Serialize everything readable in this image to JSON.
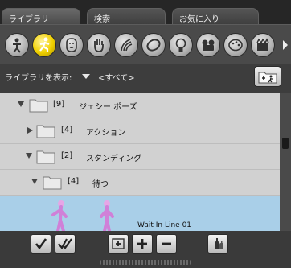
{
  "tabs": [
    {
      "label": "ライブラリ",
      "active": true
    },
    {
      "label": "検索",
      "active": false
    },
    {
      "label": "お気に入り",
      "active": false
    }
  ],
  "toolbar_icons": [
    "figure-icon",
    "pose-running-icon",
    "face-icon",
    "hand-icon",
    "hair-icon",
    "clothing-icon",
    "light-icon",
    "camera-icon",
    "materials-icon",
    "scene-icon"
  ],
  "library": {
    "label": "ライブラリを表示:",
    "value": "<すべて>"
  },
  "tree": [
    {
      "count": "[9]",
      "name": "ジェシー ポーズ",
      "expanded": true
    },
    {
      "count": "[4]",
      "name": "アクション",
      "expanded": false
    },
    {
      "count": "[2]",
      "name": "スタンディング",
      "expanded": true
    },
    {
      "count": "[4]",
      "name": "待つ",
      "expanded": true
    }
  ],
  "thumbnail": {
    "name": "Wait In Line 01"
  },
  "scrollbar": {
    "marker": "0"
  },
  "colors": {
    "active_icon": "#f0d000",
    "selected_row": "#a9cfe8",
    "row_bg": "#d1d1d1"
  }
}
